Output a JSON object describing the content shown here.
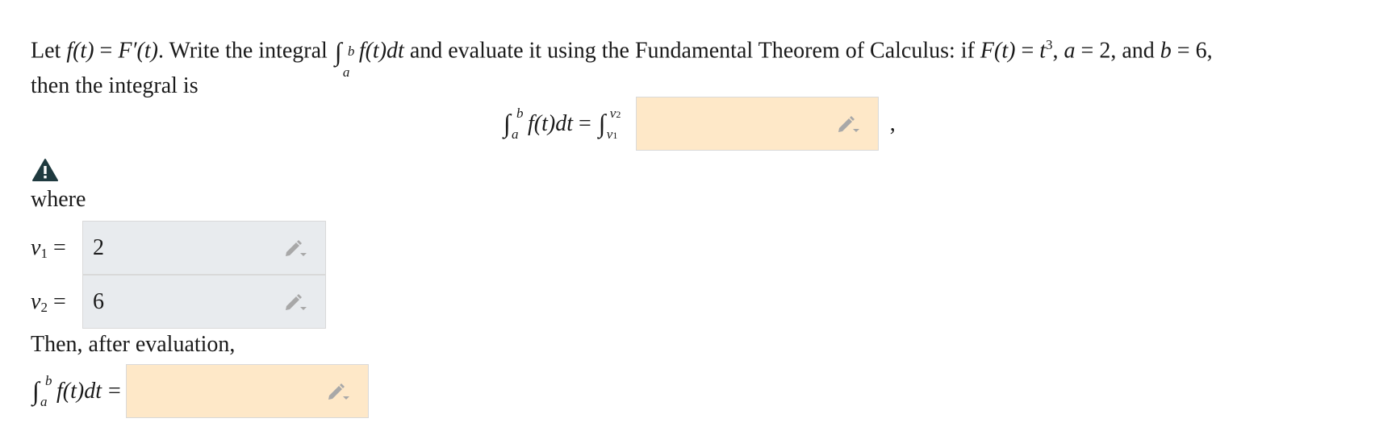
{
  "problem": {
    "line1_prefix": "Let ",
    "f_of_t": "f(t)",
    "eq": " = ",
    "F_prime": "F′(t)",
    "line1_mid": ". Write the integral ",
    "integrand": "f(t)dt",
    "line1_mid2": " and evaluate it using the Fundamental Theorem of Calculus: if ",
    "F_of_t": "F(t)",
    "t": "t",
    "t_exp": "3",
    "comma_a": ", ",
    "a_var": "a",
    "a_val": "2",
    "and_b": ", and ",
    "b_var": "b",
    "b_val": "6",
    "end_comma": ",",
    "line2": "then the integral is"
  },
  "integral": {
    "sign": "∫",
    "upper": "b",
    "lower": "a",
    "upper_v": "v",
    "upper_v_sub": "2",
    "lower_v": "v",
    "lower_v_sub": "1",
    "after_comma": ","
  },
  "integrand_input": {
    "value": ""
  },
  "where_label": "where",
  "v1": {
    "label": "v",
    "sub": "1",
    "eq": "=",
    "value": "2"
  },
  "v2": {
    "label": "v",
    "sub": "2",
    "eq": "=",
    "value": "6"
  },
  "then_label": "Then, after evaluation,",
  "final": {
    "eq": "=",
    "value": ""
  },
  "colors": {
    "peach_input": "#fee8c8",
    "gray_input": "#e8ebee",
    "warning": "#1f3a3f",
    "pencil": "#a8a8a8"
  }
}
